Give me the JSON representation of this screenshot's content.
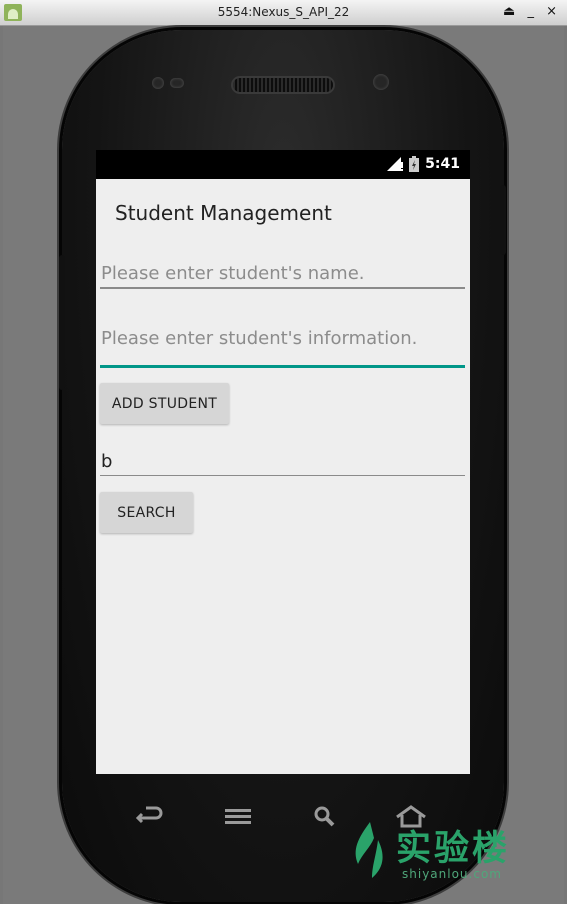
{
  "window": {
    "title": "5554:Nexus_S_API_22",
    "controls": [
      "⏏",
      "_",
      "×"
    ]
  },
  "statusbar": {
    "time": "5:41"
  },
  "app": {
    "title": "Student Management",
    "name_input": {
      "value": "",
      "placeholder": "Please enter student's name."
    },
    "info_input": {
      "value": "",
      "placeholder": "Please enter student's information."
    },
    "add_button": "ADD STUDENT",
    "search_input": {
      "value": "b",
      "placeholder": ""
    },
    "search_button": "SEARCH"
  },
  "colors": {
    "accent": "#009688",
    "background": "#eeeeee",
    "button": "#d6d6d6"
  },
  "icons": [
    "android-icon",
    "eject-icon",
    "minimize-icon",
    "close-icon",
    "signal-icon",
    "battery-icon",
    "back-icon",
    "menu-icon",
    "search-icon",
    "home-icon",
    "shiyanlou-logo-icon"
  ],
  "watermark": {
    "text": "实验楼",
    "subtext": "shiyanlou.com"
  }
}
